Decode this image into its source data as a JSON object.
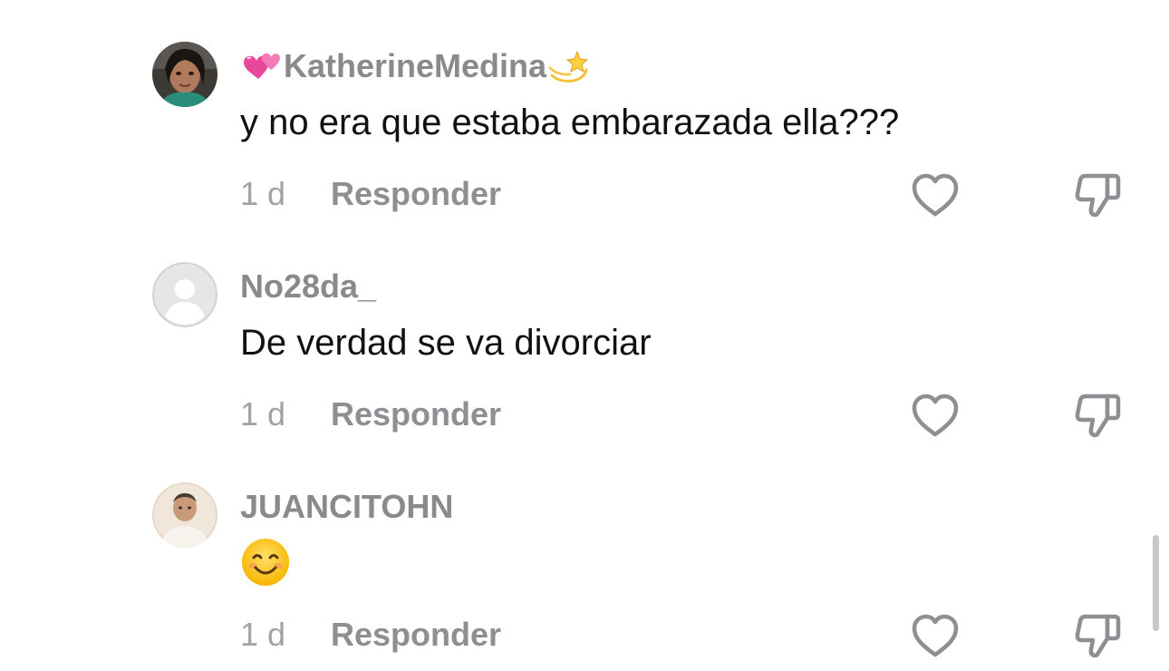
{
  "comments": [
    {
      "username": "KatherineMedina",
      "username_prefix_icon": "two-hearts-icon",
      "username_suffix_icon": "dizzy-star-icon",
      "text": "y no era que estaba embarazada ella???",
      "time": "1 d",
      "reply_label": "Responder"
    },
    {
      "username": "No28da_",
      "text": "De verdad se va divorciar",
      "time": "1 d",
      "reply_label": "Responder"
    },
    {
      "username": "JUANCITOHN",
      "text_emoji": "smiling-face-emoji",
      "time": "1 d",
      "reply_label": "Responder"
    }
  ],
  "colors": {
    "username": "#8a8a8e",
    "comment_text": "#111111",
    "meta": "#9a9a9e",
    "icon_stroke": "#8e8e93",
    "scrollbar": "#c7c7cc"
  }
}
